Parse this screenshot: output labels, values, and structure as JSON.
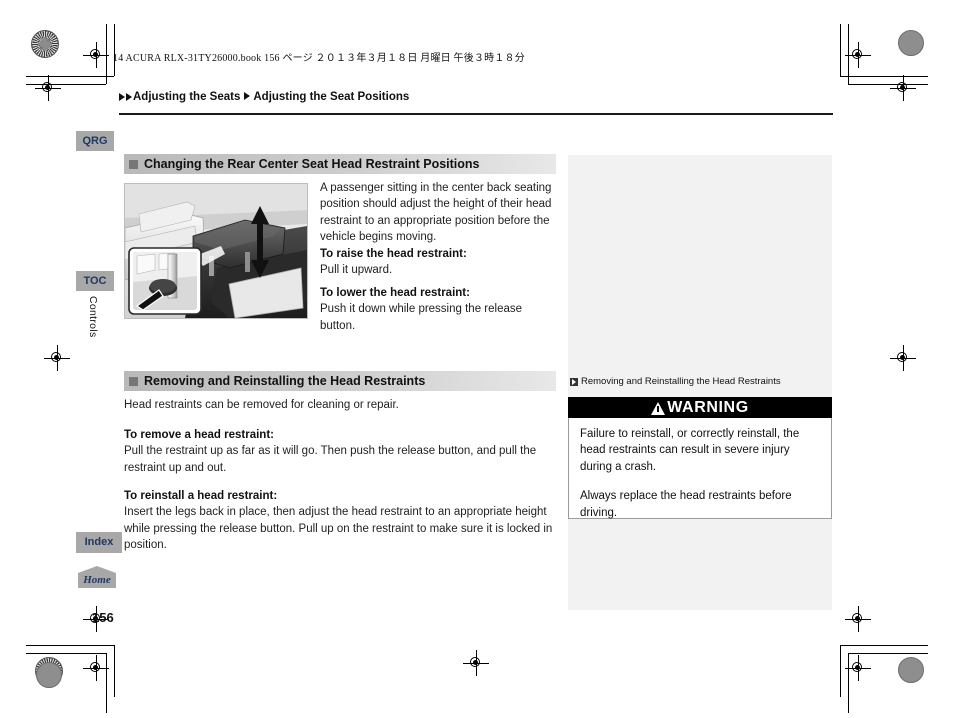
{
  "print": {
    "book_header": "14 ACURA RLX-31TY26000.book   156 ページ   ２０１３年３月１８日   月曜日   午後３時１８分"
  },
  "breadcrumb": {
    "level1": "Adjusting the Seats",
    "level2": "Adjusting the Seat Positions"
  },
  "side_tabs": {
    "qrg": "QRG",
    "toc": "TOC",
    "index": "Index",
    "home": "Home",
    "chapter": "Controls"
  },
  "sections": [
    {
      "id": "changing-rear-center-head-restraint",
      "title": "Changing the Rear Center Seat Head Restraint Positions",
      "intro": "A passenger sitting in the center back seating position should adjust the height of their head restraint to an appropriate position before the vehicle begins moving.",
      "steps": [
        {
          "heading": "To raise the head restraint:",
          "text": "Pull it upward."
        },
        {
          "heading": "To lower the head restraint:",
          "text": "Push it down while pressing the release button."
        }
      ]
    },
    {
      "id": "removing-reinstalling-head-restraints",
      "title": "Removing and Reinstalling the Head Restraints",
      "intro": "Head restraints can be removed for cleaning or repair.",
      "steps": [
        {
          "heading": "To remove a head restraint:",
          "text": "Pull the restraint up as far as it will go. Then push the release button, and pull the restraint up and out."
        },
        {
          "heading": "To reinstall a head restraint:",
          "text": "Insert the legs back in place, then adjust the head restraint to an appropriate height while pressing the release button. Pull up on the restraint to make sure it is locked in position."
        }
      ]
    }
  ],
  "figure": {
    "alt": "Rear center seat head restraint with up and down adjustment arrows and inset detail of the release button"
  },
  "side_column": {
    "caption": "Removing and Reinstalling the Head Restraints",
    "warning_title": "WARNING",
    "warning_paragraphs": [
      "Failure to reinstall, or correctly reinstall, the head restraints can result in severe injury during a crash.",
      "Always replace the head restraints before driving."
    ]
  },
  "page_number": "156",
  "colors": {
    "tab_bg": "#a8a8a8",
    "tab_text": "#1f3864",
    "section_head_bg": "#c4c4c4",
    "side_panel_bg": "#f2f2f2",
    "warning_bar_bg": "#000000"
  }
}
